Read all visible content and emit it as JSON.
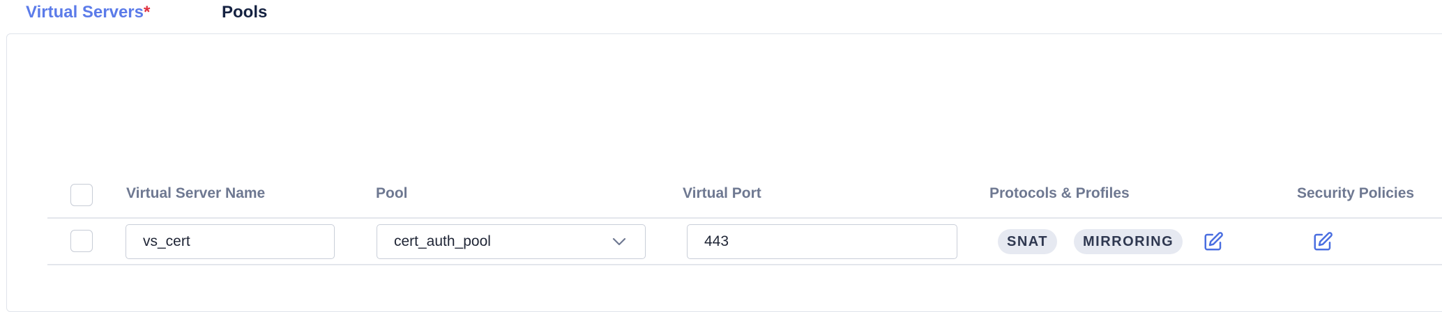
{
  "tabs": {
    "virtual_servers": {
      "label": "Virtual Servers",
      "required_marker": "*"
    },
    "pools": {
      "label": "Pools"
    }
  },
  "table": {
    "columns": {
      "name": "Virtual Server Name",
      "pool": "Pool",
      "port": "Virtual Port",
      "protocols": "Protocols & Profiles",
      "security": "Security Policies"
    },
    "rows": [
      {
        "name": "vs_cert",
        "pool": "cert_auth_pool",
        "port": "443",
        "profiles": [
          "SNAT",
          "MIRRORING"
        ]
      }
    ]
  },
  "icons": {
    "edit": "edit-icon",
    "chevron": "chevron-down-icon"
  },
  "colors": {
    "active_tab": "#5b7be9",
    "required": "#e0303f",
    "edit_icon": "#4a6ee0",
    "badge_bg": "#e6e9f1"
  }
}
